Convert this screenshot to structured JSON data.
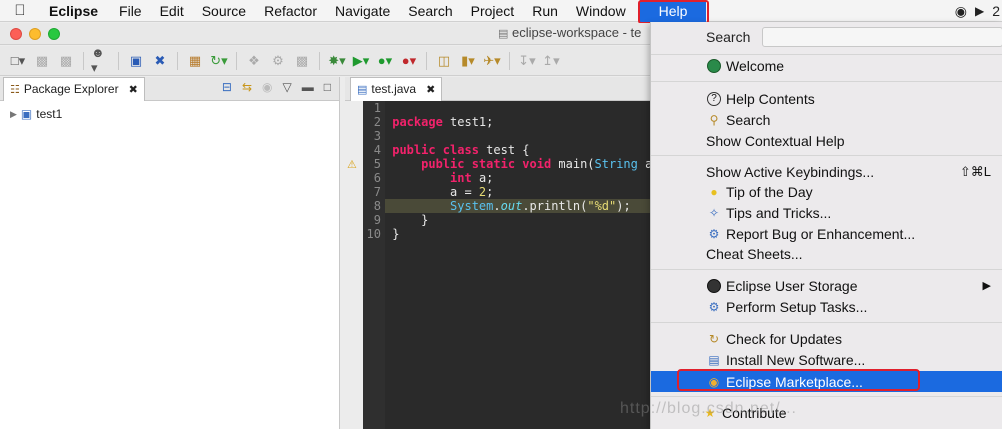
{
  "menubar": {
    "app": "Eclipse",
    "items": [
      "File",
      "Edit",
      "Source",
      "Refactor",
      "Navigate",
      "Search",
      "Project",
      "Run",
      "Window"
    ],
    "help": "Help",
    "right_badge": "2"
  },
  "window": {
    "title": "eclipse-workspace - te"
  },
  "package_explorer": {
    "tab_label": "Package Explorer",
    "tree": [
      {
        "label": "test1"
      }
    ]
  },
  "editor": {
    "tab_label": "test.java",
    "line_numbers": [
      "1",
      "2",
      "3",
      "4",
      "5",
      "6",
      "7",
      "8",
      "9",
      "10"
    ]
  },
  "help_menu": {
    "search_label": "Search",
    "items": [
      {
        "label": "Welcome",
        "icon": "welcome-icon"
      },
      {
        "label": "Help Contents",
        "icon": "help-circle-icon"
      },
      {
        "label": "Search",
        "icon": "search-help-icon"
      },
      {
        "label": "Show Contextual Help"
      },
      {
        "label": "Show Active Keybindings...",
        "shortcut": "⇧⌘L"
      },
      {
        "label": "Tip of the Day",
        "icon": "lightbulb-icon"
      },
      {
        "label": "Tips and Tricks...",
        "icon": "tips-icon"
      },
      {
        "label": "Report Bug or Enhancement...",
        "icon": "bug-icon"
      },
      {
        "label": "Cheat Sheets..."
      },
      {
        "label": "Eclipse User Storage",
        "icon": "user-icon"
      },
      {
        "label": "Perform Setup Tasks...",
        "icon": "setup-icon"
      },
      {
        "label": "Check for Updates",
        "icon": "update-icon"
      },
      {
        "label": "Install New Software...",
        "icon": "install-icon"
      },
      {
        "label": "Eclipse Marketplace...",
        "icon": "marketplace-icon"
      },
      {
        "label": "Contribute",
        "icon": "star-icon"
      }
    ]
  },
  "watermark": "http://blog.csdn.net/...",
  "colors": {
    "accent": "#1b6ae0",
    "highlight_outline": "#e0202c",
    "editor_bg": "#2a2a2a"
  }
}
